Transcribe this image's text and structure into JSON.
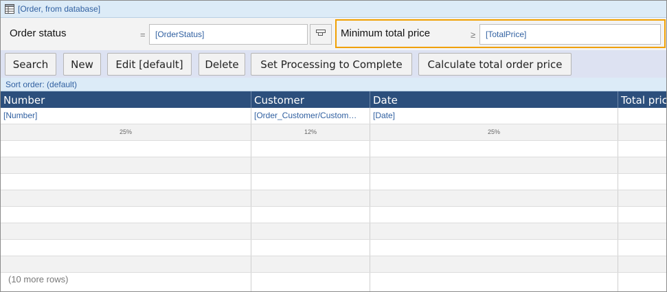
{
  "window": {
    "title": "[Order, from database]",
    "icon": "table-grid-icon"
  },
  "filters": {
    "order_status": {
      "label": "Order status",
      "operator": "=",
      "value": "[OrderStatus]"
    },
    "picker_icon": "lookup-picker-icon",
    "minimum_total_price": {
      "label": "Minimum total price",
      "operator": "≥",
      "value": "[TotalPrice]"
    },
    "highlight_color": "#f0a000"
  },
  "toolbar": {
    "search": "Search",
    "new": "New",
    "edit": "Edit [default]",
    "delete": "Delete",
    "set_processing": "Set Processing to Complete",
    "calculate": "Calculate total order price"
  },
  "sort": {
    "label": "Sort order: (default)"
  },
  "table": {
    "headers": [
      "Number",
      "Customer",
      "Date",
      "Total pric"
    ],
    "binding_row": [
      "[Number]",
      "[Order_Customer/Custom…",
      "[Date]",
      ""
    ],
    "width_row": [
      "25%",
      "12%",
      "25%",
      ""
    ],
    "more_rows": "(10 more rows)",
    "header_color": "#2c4f7c"
  }
}
